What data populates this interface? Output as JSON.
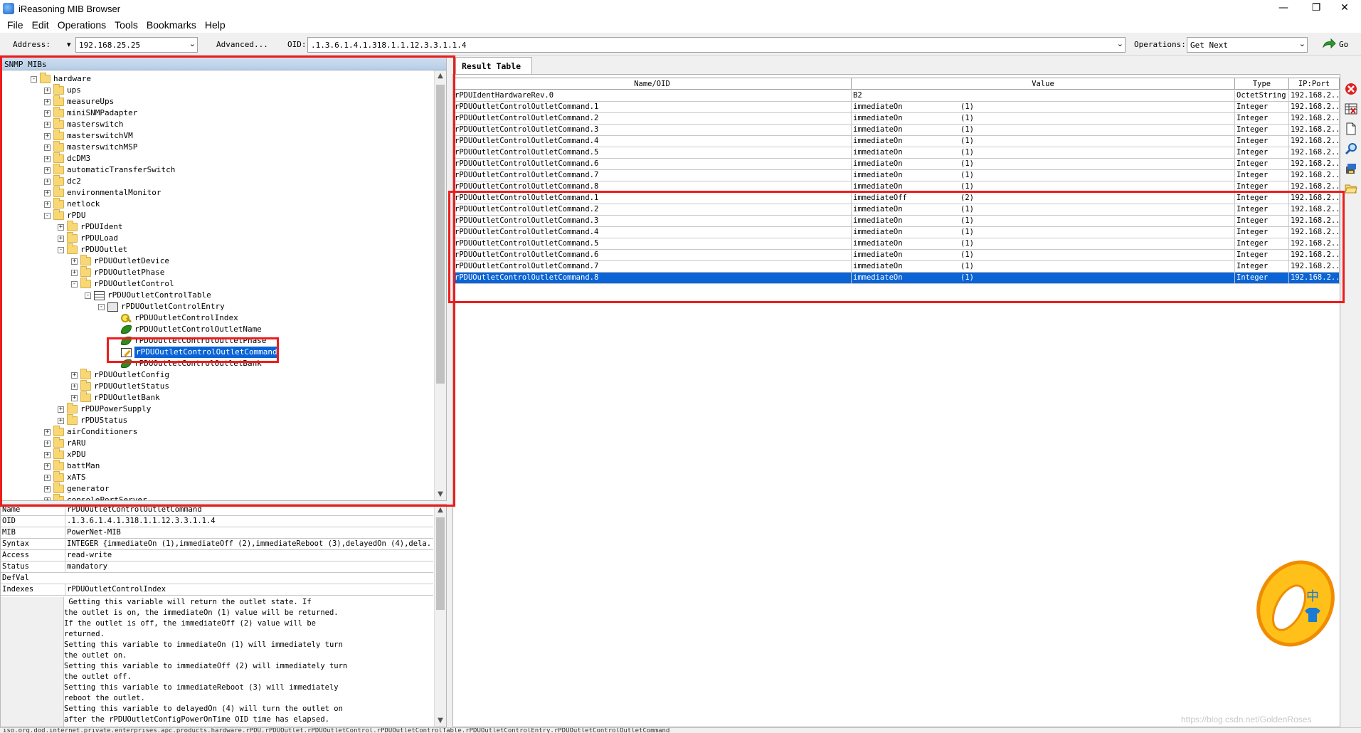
{
  "window": {
    "title": "iReasoning MIB Browser",
    "controls": [
      "—",
      "❐",
      "✕"
    ]
  },
  "menu": [
    "File",
    "Edit",
    "Operations",
    "Tools",
    "Bookmarks",
    "Help"
  ],
  "toolbar": {
    "address_label": "Address:",
    "address_value": "192.168.25.25",
    "advanced_label": "Advanced...",
    "oid_label": "OID:",
    "oid_value": ".1.3.6.1.4.1.318.1.1.12.3.3.1.1.4",
    "operations_label": "Operations:",
    "operations_value": "Get Next",
    "go_label": "Go"
  },
  "tree": {
    "header": "SNMP MIBs",
    "nodes": [
      {
        "label": "hardware",
        "level": 0,
        "icon": "folder",
        "expander": "-"
      },
      {
        "label": "ups",
        "level": 1,
        "icon": "folder",
        "expander": "+"
      },
      {
        "label": "measureUps",
        "level": 1,
        "icon": "folder",
        "expander": "+"
      },
      {
        "label": "miniSNMPadapter",
        "level": 1,
        "icon": "folder",
        "expander": "+"
      },
      {
        "label": "masterswitch",
        "level": 1,
        "icon": "folder",
        "expander": "+"
      },
      {
        "label": "masterswitchVM",
        "level": 1,
        "icon": "folder",
        "expander": "+"
      },
      {
        "label": "masterswitchMSP",
        "level": 1,
        "icon": "folder",
        "expander": "+"
      },
      {
        "label": "dcDM3",
        "level": 1,
        "icon": "folder",
        "expander": "+"
      },
      {
        "label": "automaticTransferSwitch",
        "level": 1,
        "icon": "folder",
        "expander": "+"
      },
      {
        "label": "dc2",
        "level": 1,
        "icon": "folder",
        "expander": "+"
      },
      {
        "label": "environmentalMonitor",
        "level": 1,
        "icon": "folder",
        "expander": "+"
      },
      {
        "label": "netlock",
        "level": 1,
        "icon": "folder",
        "expander": "+"
      },
      {
        "label": "rPDU",
        "level": 1,
        "icon": "folder",
        "expander": "-"
      },
      {
        "label": "rPDUIdent",
        "level": 2,
        "icon": "folder",
        "expander": "+"
      },
      {
        "label": "rPDULoad",
        "level": 2,
        "icon": "folder",
        "expander": "+"
      },
      {
        "label": "rPDUOutlet",
        "level": 2,
        "icon": "folder",
        "expander": "-"
      },
      {
        "label": "rPDUOutletDevice",
        "level": 3,
        "icon": "folder",
        "expander": "+"
      },
      {
        "label": "rPDUOutletPhase",
        "level": 3,
        "icon": "folder",
        "expander": "+"
      },
      {
        "label": "rPDUOutletControl",
        "level": 3,
        "icon": "folder",
        "expander": "-"
      },
      {
        "label": "rPDUOutletControlTable",
        "level": 4,
        "icon": "table",
        "expander": "-"
      },
      {
        "label": "rPDUOutletControlEntry",
        "level": 5,
        "icon": "entry",
        "expander": "-"
      },
      {
        "label": "rPDUOutletControlIndex",
        "level": 6,
        "icon": "key",
        "expander": ""
      },
      {
        "label": "rPDUOutletControlOutletName",
        "level": 6,
        "icon": "leaf",
        "expander": ""
      },
      {
        "label": "rPDUOutletControlOutletPhase",
        "level": 6,
        "icon": "leaf",
        "expander": ""
      },
      {
        "label": "rPDUOutletControlOutletCommand",
        "level": 6,
        "icon": "edit",
        "expander": "",
        "selected": true
      },
      {
        "label": "rPDUOutletControlOutletBank",
        "level": 6,
        "icon": "leaf",
        "expander": ""
      },
      {
        "label": "rPDUOutletConfig",
        "level": 3,
        "icon": "folder",
        "expander": "+"
      },
      {
        "label": "rPDUOutletStatus",
        "level": 3,
        "icon": "folder",
        "expander": "+"
      },
      {
        "label": "rPDUOutletBank",
        "level": 3,
        "icon": "folder",
        "expander": "+"
      },
      {
        "label": "rPDUPowerSupply",
        "level": 2,
        "icon": "folder",
        "expander": "+"
      },
      {
        "label": "rPDUStatus",
        "level": 2,
        "icon": "folder",
        "expander": "+"
      },
      {
        "label": "airConditioners",
        "level": 1,
        "icon": "folder",
        "expander": "+"
      },
      {
        "label": "rARU",
        "level": 1,
        "icon": "folder",
        "expander": "+"
      },
      {
        "label": "xPDU",
        "level": 1,
        "icon": "folder",
        "expander": "+"
      },
      {
        "label": "battMan",
        "level": 1,
        "icon": "folder",
        "expander": "+"
      },
      {
        "label": "xATS",
        "level": 1,
        "icon": "folder",
        "expander": "+"
      },
      {
        "label": "generator",
        "level": 1,
        "icon": "folder",
        "expander": "+"
      },
      {
        "label": "consolePortServer",
        "level": 1,
        "icon": "folder",
        "expander": "+"
      }
    ]
  },
  "properties": [
    {
      "key": "Name",
      "value": "rPDUOutletControlOutletCommand"
    },
    {
      "key": "OID",
      "value": ".1.3.6.1.4.1.318.1.1.12.3.3.1.1.4"
    },
    {
      "key": "MIB",
      "value": "PowerNet-MIB"
    },
    {
      "key": "Syntax",
      "value": "INTEGER {immediateOn (1),immediateOff (2),immediateReboot (3),delayedOn (4),dela..."
    },
    {
      "key": "Access",
      "value": "read-write"
    },
    {
      "key": "Status",
      "value": "mandatory"
    },
    {
      "key": "DefVal",
      "value": ""
    },
    {
      "key": "Indexes",
      "value": "rPDUOutletControlIndex"
    }
  ],
  "description": " Getting this variable will return the outlet state. If\nthe outlet is on, the immediateOn (1) value will be returned.\nIf the outlet is off, the immediateOff (2) value will be\nreturned.\nSetting this variable to immediateOn (1) will immediately turn\nthe outlet on.\nSetting this variable to immediateOff (2) will immediately turn\nthe outlet off.\nSetting this variable to immediateReboot (3) will immediately\nreboot the outlet.\nSetting this variable to delayedOn (4) will turn the outlet on\nafter the rPDUOutletConfigPowerOnTime OID time has elapsed.",
  "result": {
    "tab_label": "Result Table",
    "columns": [
      "Name/OID",
      "Value",
      "Type",
      "IP:Port"
    ],
    "rows": [
      {
        "name": "rPDUIdentHardwareRev.0",
        "value": "B2",
        "code": "",
        "type": "OctetString",
        "ip": "192.168.2..."
      },
      {
        "name": "rPDUOutletControlOutletCommand.1",
        "value": "immediateOn",
        "code": "(1)",
        "type": "Integer",
        "ip": "192.168.2..."
      },
      {
        "name": "rPDUOutletControlOutletCommand.2",
        "value": "immediateOn",
        "code": "(1)",
        "type": "Integer",
        "ip": "192.168.2..."
      },
      {
        "name": "rPDUOutletControlOutletCommand.3",
        "value": "immediateOn",
        "code": "(1)",
        "type": "Integer",
        "ip": "192.168.2..."
      },
      {
        "name": "rPDUOutletControlOutletCommand.4",
        "value": "immediateOn",
        "code": "(1)",
        "type": "Integer",
        "ip": "192.168.2..."
      },
      {
        "name": "rPDUOutletControlOutletCommand.5",
        "value": "immediateOn",
        "code": "(1)",
        "type": "Integer",
        "ip": "192.168.2..."
      },
      {
        "name": "rPDUOutletControlOutletCommand.6",
        "value": "immediateOn",
        "code": "(1)",
        "type": "Integer",
        "ip": "192.168.2..."
      },
      {
        "name": "rPDUOutletControlOutletCommand.7",
        "value": "immediateOn",
        "code": "(1)",
        "type": "Integer",
        "ip": "192.168.2..."
      },
      {
        "name": "rPDUOutletControlOutletCommand.8",
        "value": "immediateOn",
        "code": "(1)",
        "type": "Integer",
        "ip": "192.168.2..."
      },
      {
        "name": "rPDUOutletControlOutletCommand.1",
        "value": "immediateOff",
        "code": "(2)",
        "type": "Integer",
        "ip": "192.168.2..."
      },
      {
        "name": "rPDUOutletControlOutletCommand.2",
        "value": "immediateOn",
        "code": "(1)",
        "type": "Integer",
        "ip": "192.168.2..."
      },
      {
        "name": "rPDUOutletControlOutletCommand.3",
        "value": "immediateOn",
        "code": "(1)",
        "type": "Integer",
        "ip": "192.168.2..."
      },
      {
        "name": "rPDUOutletControlOutletCommand.4",
        "value": "immediateOn",
        "code": "(1)",
        "type": "Integer",
        "ip": "192.168.2..."
      },
      {
        "name": "rPDUOutletControlOutletCommand.5",
        "value": "immediateOn",
        "code": "(1)",
        "type": "Integer",
        "ip": "192.168.2..."
      },
      {
        "name": "rPDUOutletControlOutletCommand.6",
        "value": "immediateOn",
        "code": "(1)",
        "type": "Integer",
        "ip": "192.168.2..."
      },
      {
        "name": "rPDUOutletControlOutletCommand.7",
        "value": "immediateOn",
        "code": "(1)",
        "type": "Integer",
        "ip": "192.168.2..."
      },
      {
        "name": "rPDUOutletControlOutletCommand.8",
        "value": "immediateOn",
        "code": "(1)",
        "type": "Integer",
        "ip": "192.168.2...",
        "selected": true
      }
    ]
  },
  "side_icons": [
    "stop-icon",
    "delete-table-icon",
    "new-document-icon",
    "find-icon",
    "export-icon",
    "open-folder-icon"
  ],
  "statusbar": "iso.org.dod.internet.private.enterprises.apc.products.hardware.rPDU.rPDUOutlet.rPDUOutletControl.rPDUOutletControlTable.rPDUOutletControlEntry.rPDUOutletControlOutletCommand",
  "ime_badge": {
    "label": "中"
  },
  "watermark": "https://blog.csdn.net/GoldenRoses",
  "colors": {
    "selection": "#0a64d6",
    "annotation": "#ee1c1c",
    "folder": "#f8d775",
    "tree_header": "#b7cde6"
  }
}
